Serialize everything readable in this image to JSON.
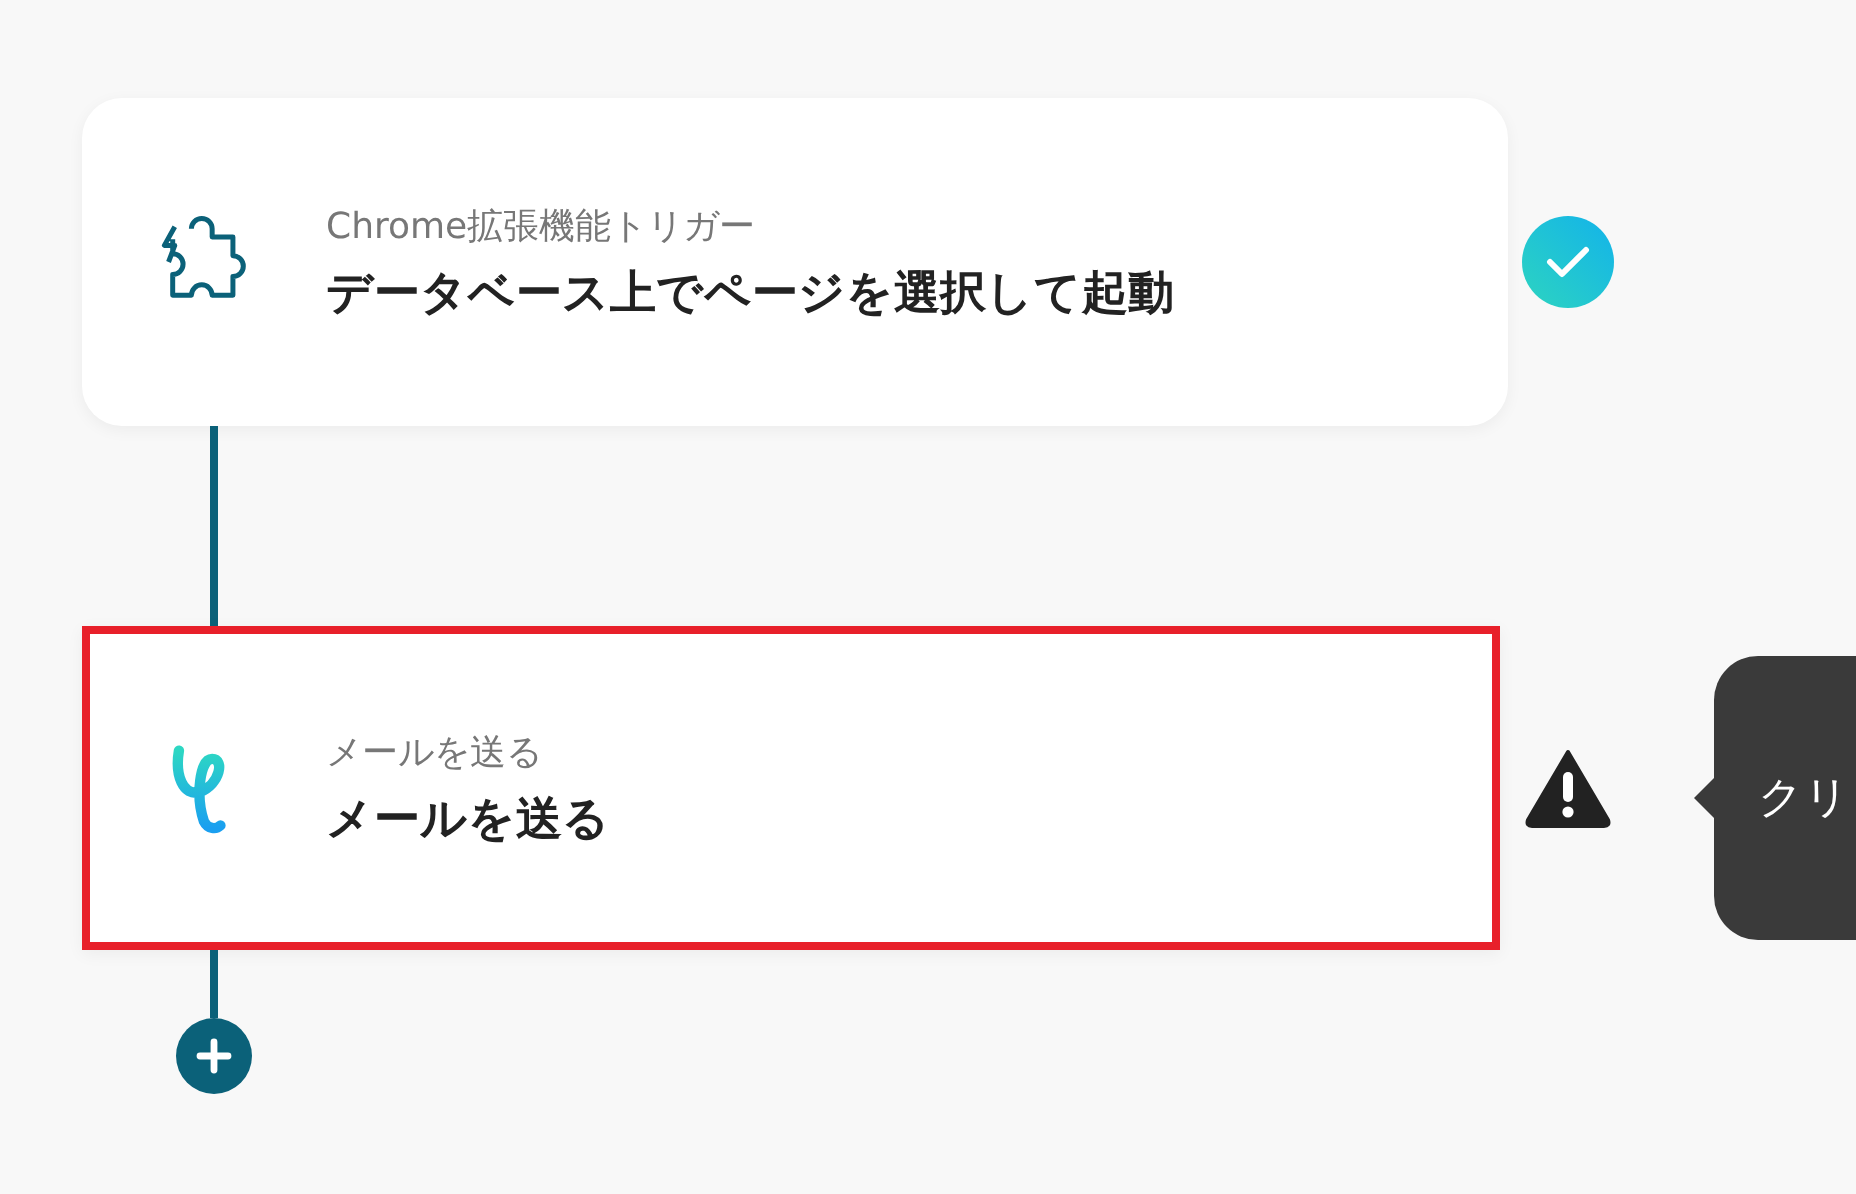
{
  "steps": [
    {
      "kind": "chrome",
      "subtitle": "Chrome拡張機能トリガー",
      "title": "データベース上でページを選択して起動",
      "completed": true,
      "highlighted": false
    },
    {
      "kind": "mail",
      "subtitle": "メールを送る",
      "title": "メールを送る",
      "completed": false,
      "highlighted": true
    }
  ],
  "tooltip": {
    "text": "クリ"
  }
}
